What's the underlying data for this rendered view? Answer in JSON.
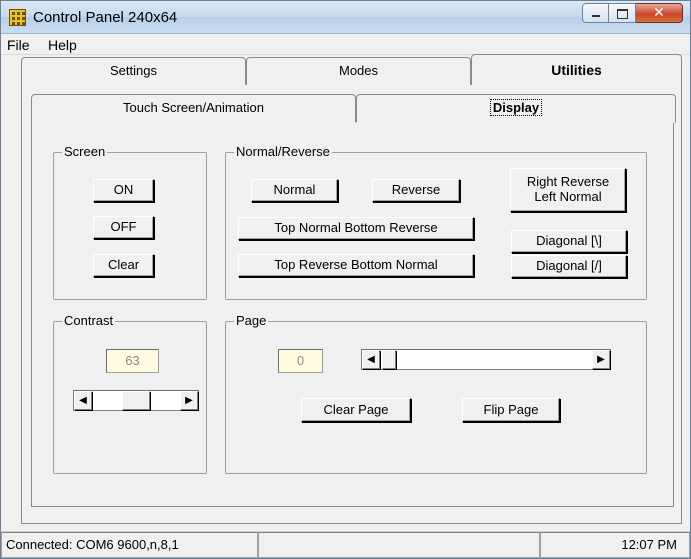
{
  "window": {
    "title": "Control Panel 240x64"
  },
  "menu": [
    "File",
    "Help"
  ],
  "main_tabs": [
    "Settings",
    "Modes",
    "Utilities"
  ],
  "sub_tabs": [
    "Touch Screen/Animation",
    "Display"
  ],
  "screen_group": {
    "label": "Screen",
    "buttons": [
      "ON",
      "OFF",
      "Clear"
    ]
  },
  "normal_reverse_group": {
    "label": "Normal/Reverse",
    "normal": "Normal",
    "reverse": "Reverse",
    "right_reverse_line1": "Right Reverse",
    "right_reverse_line2": "Left Normal",
    "top_normal_bottom_reverse": "Top Normal Bottom Reverse",
    "top_reverse_bottom_normal": "Top Reverse Bottom Normal",
    "diagonal_back": "Diagonal [\\]",
    "diagonal_fwd": "Diagonal [/]"
  },
  "contrast_group": {
    "label": "Contrast",
    "value": "63",
    "slider_level": 0.5
  },
  "page_group": {
    "label": "Page",
    "value": "0",
    "slider_level": 0.0,
    "clear_page": "Clear Page",
    "flip_page": "Flip Page"
  },
  "status": {
    "connection": "Connected: COM6 9600,n,8,1",
    "time": "12:07 PM"
  }
}
